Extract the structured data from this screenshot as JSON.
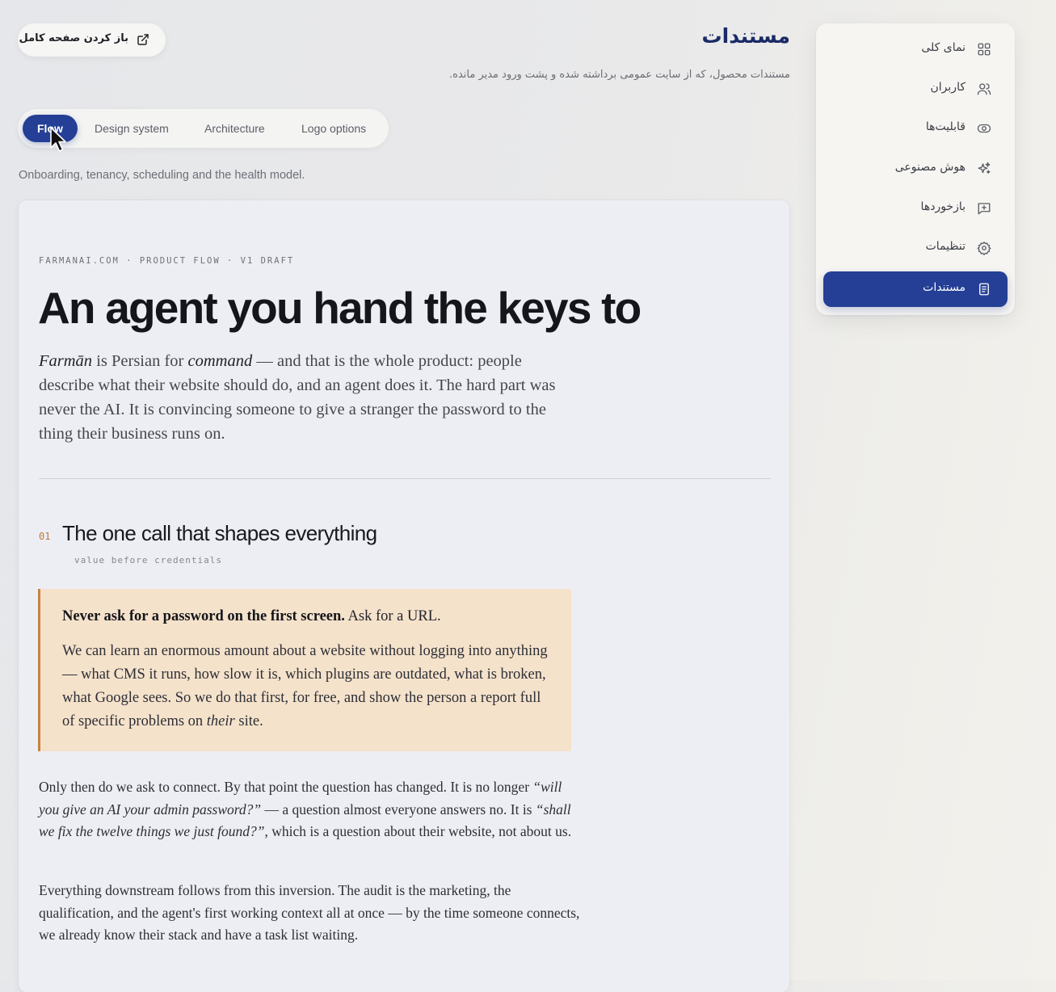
{
  "header": {
    "open_full_label": "باز کردن صفحه کامل",
    "title": "مستندات",
    "subtitle": "مستندات محصول، که از سایت عمومی برداشته شده و پشت ورود مدیر مانده."
  },
  "sidebar": {
    "items": [
      {
        "label": "نمای کلی",
        "icon": "grid-icon"
      },
      {
        "label": "کاربران",
        "icon": "users-icon"
      },
      {
        "label": "قابلیت‌ها",
        "icon": "eye-icon"
      },
      {
        "label": "هوش مصنوعی",
        "icon": "sparkles-icon"
      },
      {
        "label": "بازخوردها",
        "icon": "message-plus-icon"
      },
      {
        "label": "تنظیمات",
        "icon": "gear-icon"
      },
      {
        "label": "مستندات",
        "icon": "document-icon",
        "active": true
      }
    ]
  },
  "tabs": {
    "items": [
      "Flow",
      "Design system",
      "Architecture",
      "Logo options"
    ],
    "active": "Flow",
    "description": "Onboarding, tenancy, scheduling and the health model."
  },
  "doc": {
    "eyebrow": "FARMANAI.COM · PRODUCT FLOW · V1 DRAFT",
    "title": "An agent you hand the keys to",
    "lede": {
      "term": "Farmān",
      "t1": " is Persian for ",
      "word": "command",
      "t2": " — and that is the whole product: people describe what their website should do, and an agent does it. The hard part was never the AI. It is convincing someone to give a stranger the password to the thing their business runs on."
    },
    "section": {
      "number": "01",
      "title": "The one call that shapes everything",
      "subtitle": "value before credentials"
    },
    "callout": {
      "lead_bold": "Never ask for a password on the first screen.",
      "lead_rest": " Ask for a URL.",
      "body_a": "We can learn an enormous amount about a website without logging into anything — what CMS it runs, how slow it is, which plugins are outdated, what is broken, what Google sees. So we do that first, for free, and show the person a report full of specific problems on ",
      "body_em": "their",
      "body_b": " site."
    },
    "para1": {
      "a": "Only then do we ask to connect. By that point the question has changed. It is no longer ",
      "q1": "“will you give an AI your admin password?”",
      "b": " — a question almost everyone answers no. It is ",
      "q2": "“shall we fix the twelve things we just found?”",
      "c": ", which is a question about their website, not about us."
    },
    "para2": "Everything downstream follows from this inversion. The audit is the marketing, the qualification, and the agent's first working context all at once — by the time someone connects, we already know their stack and have a task list waiting."
  },
  "colors": {
    "accent": "#243f95",
    "title": "#1a2a66",
    "callout_bg": "#f5e2cb",
    "callout_border": "#c7833f",
    "section_number": "#c0783a"
  }
}
